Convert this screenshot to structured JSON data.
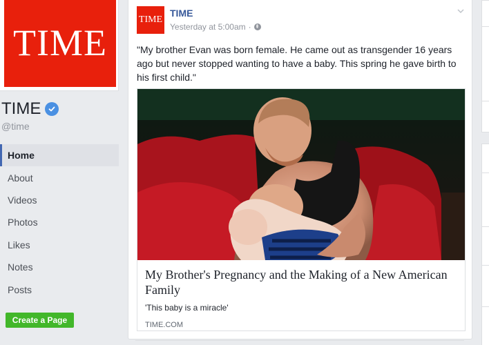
{
  "page": {
    "logo_text": "TIME",
    "name": "TIME",
    "handle": "@time",
    "create_page_label": "Create a Page"
  },
  "nav": {
    "items": [
      {
        "label": "Home",
        "active": true
      },
      {
        "label": "About"
      },
      {
        "label": "Videos"
      },
      {
        "label": "Photos"
      },
      {
        "label": "Likes"
      },
      {
        "label": "Notes"
      },
      {
        "label": "Posts"
      }
    ]
  },
  "post": {
    "avatar_text": "TIME",
    "author": "TIME",
    "timestamp": "Yesterday at 5:00am",
    "separator": "·",
    "caption": "\"My brother Evan was born female. He came out as transgender 16 years ago but never stopped wanting to have a baby. This spring he gave birth to his first child.\"",
    "link": {
      "title": "My Brother's Pregnancy and the Making of a New American Family",
      "description": "'This baby is a miracle'",
      "domain": "TIME.COM"
    }
  },
  "colors": {
    "brand_red": "#e8200c",
    "link_blue": "#365899",
    "verified_blue": "#4a90e2",
    "create_green": "#42b72a",
    "background": "#e9ebee"
  },
  "icons": {
    "verified": "verified-badge-icon",
    "audience": "globe-icon",
    "menu": "chevron-down-icon"
  }
}
